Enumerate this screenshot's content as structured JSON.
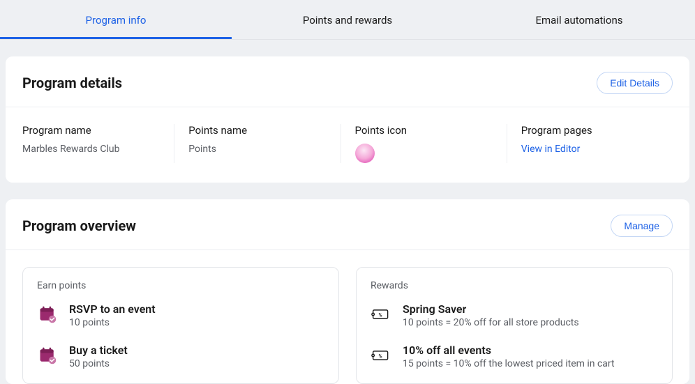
{
  "tabs": {
    "program_info": "Program info",
    "points_rewards": "Points and rewards",
    "email_automations": "Email automations"
  },
  "details": {
    "title": "Program details",
    "edit_button": "Edit Details",
    "program_name_label": "Program name",
    "program_name_value": "Marbles Rewards Club",
    "points_name_label": "Points name",
    "points_name_value": "Points",
    "points_icon_label": "Points icon",
    "program_pages_label": "Program pages",
    "view_editor": "View in Editor"
  },
  "overview": {
    "title": "Program overview",
    "manage_button": "Manage",
    "earn": {
      "heading": "Earn points",
      "items": [
        {
          "title": "RSVP to an event",
          "sub": "10 points"
        },
        {
          "title": "Buy a ticket",
          "sub": "50 points"
        }
      ]
    },
    "rewards": {
      "heading": "Rewards",
      "items": [
        {
          "title": "Spring Saver",
          "sub": "10 points = 20% off for all store products"
        },
        {
          "title": "10% off all events",
          "sub": "15 points = 10% off the lowest priced item in cart"
        }
      ]
    }
  }
}
